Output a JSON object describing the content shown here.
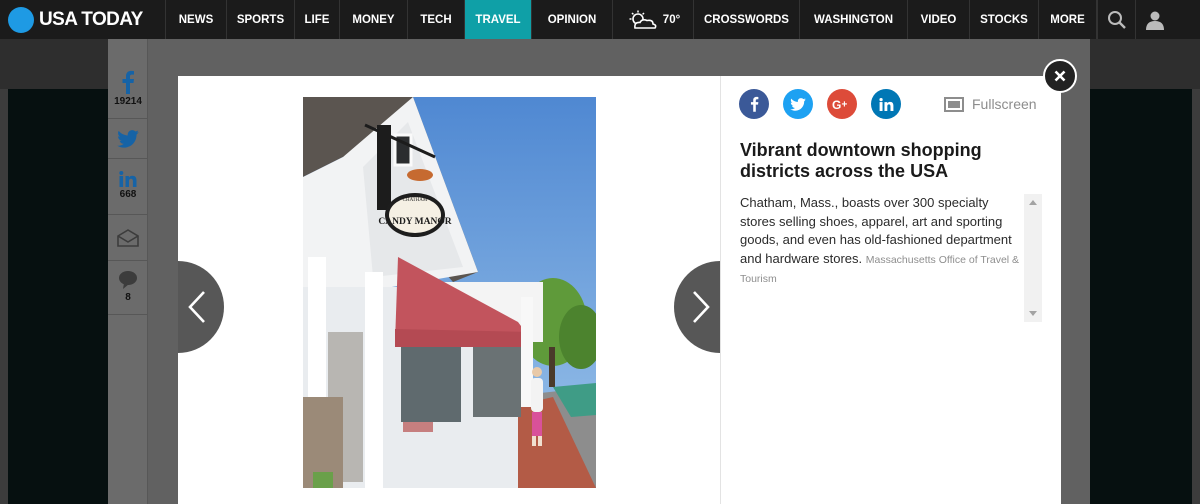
{
  "brand": {
    "name": "USA TODAY",
    "color": "#1e9ae4"
  },
  "nav": {
    "items": [
      {
        "label": "NEWS"
      },
      {
        "label": "SPORTS"
      },
      {
        "label": "LIFE"
      },
      {
        "label": "MONEY"
      },
      {
        "label": "TECH"
      },
      {
        "label": "TRAVEL",
        "active": true
      },
      {
        "label": "OPINION"
      },
      {
        "label": "CROSSWORDS"
      },
      {
        "label": "WASHINGTON"
      },
      {
        "label": "VIDEO"
      },
      {
        "label": "STOCKS"
      },
      {
        "label": "MORE"
      }
    ],
    "weather": {
      "temp": "70°",
      "icon": "partly-cloudy-icon"
    },
    "active_color": "#0fa0a7"
  },
  "share_rail": {
    "facebook_count": "19214",
    "linkedin_count": "668",
    "comment_count": "8"
  },
  "gallery": {
    "fullscreen_label": "Fullscreen",
    "title": "Vibrant downtown shopping districts across the USA",
    "caption": "Chatham, Mass., boasts over 300 specialty stores selling shoes, apparel, art and sporting goods, and even has old-fashioned department and hardware stores.",
    "credit": "Massachusetts Office of Travel & Tourism",
    "photo_sign_text": "CANDY MANOR",
    "photo_sign_small": "CHATHAM",
    "share_colors": {
      "facebook": "#3b5998",
      "twitter": "#1da1f2",
      "googleplus": "#dd4b39",
      "linkedin": "#0077b5"
    }
  }
}
